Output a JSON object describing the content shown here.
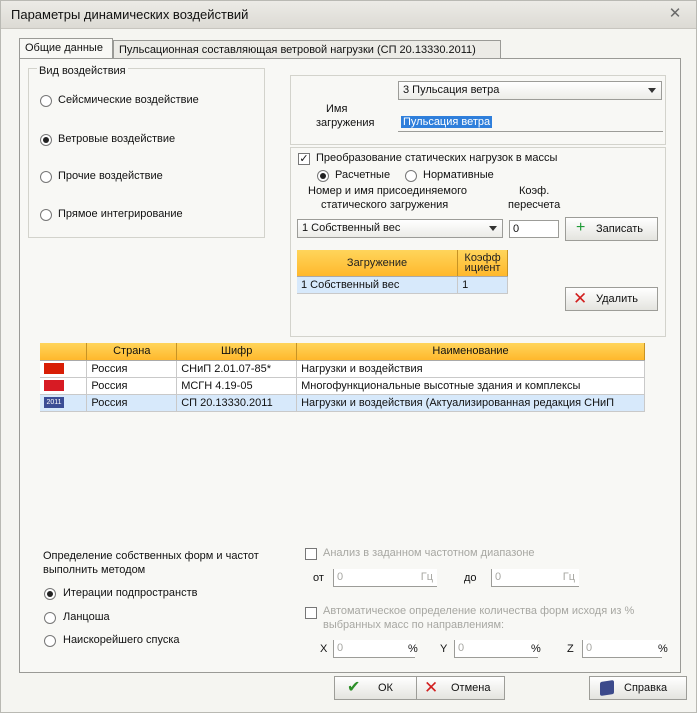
{
  "window": {
    "title": "Параметры динамических воздействий",
    "close_icon": "close-icon"
  },
  "tabs": [
    {
      "label": "Общие данные"
    },
    {
      "label": "Пульсационная составляющая ветровой нагрузки (СП 20.13330.2011)"
    }
  ],
  "impact_type": {
    "group_label": "Вид воздействия",
    "options": [
      "Сейсмические воздействие",
      "Ветровые воздействие",
      "Прочие воздействие",
      "Прямое интегрирование"
    ],
    "selected": "Ветровые воздействие"
  },
  "load": {
    "selected_option": "3 Пульсация ветра",
    "name_label_1": "Имя",
    "name_label_2": "загружения",
    "name_value": "Пульсация ветра",
    "convert_label": "Преобразование статических нагрузок в массы",
    "convert_checked": true,
    "design_label": "Расчетные",
    "normative_label": "Нормативные",
    "attached_label_1": "Номер и имя присоединяемого",
    "attached_label_2": "статического загружения",
    "coef_label_1": "Коэф.",
    "coef_label_2": "пересчета",
    "static_load_selected": "1 Собственный вес",
    "coef_value": "0",
    "write_button": "Записать",
    "delete_button": "Удалить",
    "table": {
      "headers": [
        "Загружение",
        "Коэфф\nициент"
      ],
      "rows": [
        [
          "1 Собственный вес",
          "1"
        ]
      ]
    }
  },
  "norms_table": {
    "headers": [
      "Страна",
      "Шифр",
      "Наименование"
    ],
    "rows": [
      {
        "flag": "china-flag",
        "country": "Россия",
        "code": "СНиП 2.01.07-85*",
        "name": "Нагрузки и воздействия"
      },
      {
        "flag": "russia-flag",
        "country": "Россия",
        "code": "МСГН 4.19-05",
        "name": "Многофункциональные высотные здания и комплексы"
      },
      {
        "flag": "russia-flag-2011",
        "country": "Россия",
        "code": "СП 20.13330.2011",
        "name": "Нагрузки и воздействия (Актуализированная редакция СНиП"
      }
    ],
    "selected_row": 2,
    "flag_badge": "2011"
  },
  "modes": {
    "label_1": "Определение собственных форм и частот",
    "label_2": "выполнить методом",
    "options": [
      "Итерации подпространств",
      "Ланцоша",
      "Наискорейшего спуска"
    ],
    "selected": "Итерации подпространств"
  },
  "frequency": {
    "range_label": "Анализ в заданном частотном диапазоне",
    "from_label": "от",
    "from_value": "0",
    "to_label": "до",
    "to_value": "0",
    "unit": "Гц"
  },
  "auto_forms": {
    "label_1": "Автоматическое определение количества форм исходя из %",
    "label_2": "выбранных масс по направлениям:",
    "x_label": "X",
    "x_value": "0",
    "y_label": "Y",
    "y_value": "0",
    "z_label": "Z",
    "z_value": "0",
    "unit": "%"
  },
  "buttons": {
    "ok": "ОК",
    "cancel": "Отмена",
    "help": "Справка"
  },
  "colors": {
    "header_orange": "#ffb82c",
    "selection_blue": "#d7e9fb",
    "ok_green": "#2c8f28",
    "cancel_red": "#d21f1f"
  }
}
